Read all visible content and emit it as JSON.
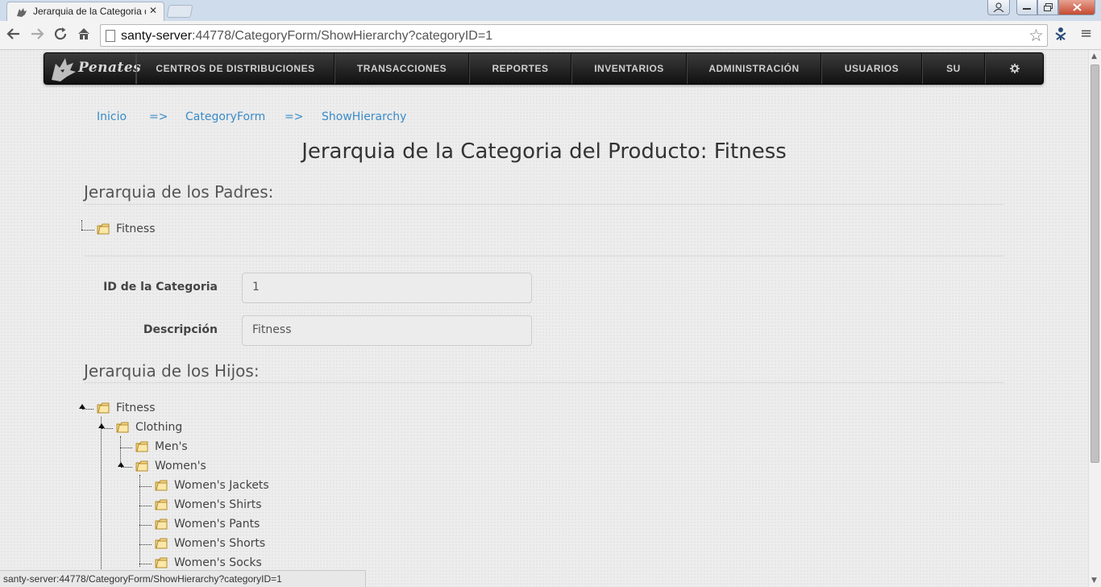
{
  "browser": {
    "tab_title": "Jerarquia de la Categoria de",
    "tab_close": "✕",
    "url_host": "santy-server",
    "url_rest": ":44778/CategoryForm/ShowHierarchy?categoryID=1",
    "status_url": "santy-server:44778/CategoryForm/ShowHierarchy?categoryID=1"
  },
  "navbar": {
    "brand": "Penates",
    "items": [
      "CENTROS DE DISTRIBUCIONES",
      "TRANSACCIONES",
      "REPORTES",
      "INVENTARIOS",
      "ADMINISTRACIÓN",
      "USUARIOS",
      "SU"
    ],
    "settings_icon": "gear-icon"
  },
  "breadcrumb": {
    "items": [
      "Inicio",
      "CategoryForm",
      "ShowHierarchy"
    ],
    "separator": "=>"
  },
  "page_title": "Jerarquia de la Categoria del Producto: Fitness",
  "parents_section": {
    "title": "Jerarquia de los Padres:",
    "nodes": [
      "Fitness"
    ]
  },
  "form": {
    "id_label": "ID de la Categoria",
    "id_value": "1",
    "desc_label": "Descripción",
    "desc_value": "Fitness"
  },
  "children_section": {
    "title": "Jerarquia de los Hijos:",
    "nodes": [
      "Fitness",
      "Clothing",
      "Men's",
      "Women's",
      "Women's Jackets",
      "Women's Shirts",
      "Women's Pants",
      "Women's Shorts",
      "Women's Socks"
    ]
  },
  "colors": {
    "link": "#3a8bc8",
    "navbar": "#1c1c1c",
    "background": "#ededed"
  }
}
